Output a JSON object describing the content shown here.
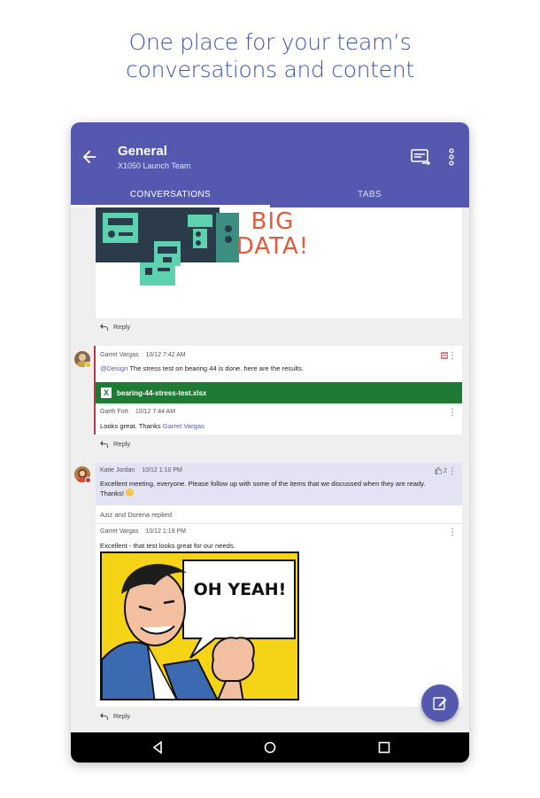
{
  "tagline": {
    "line1": "One place for your team’s",
    "line2": "conversations and content"
  },
  "appbar": {
    "title": "General",
    "subtitle": "X1050 Launch Team",
    "back_icon": "arrow-left-icon",
    "meet_icon": "meeting-icon",
    "more_icon": "more-vertical-icon",
    "color": "#5558af"
  },
  "tabs": [
    {
      "label": "CONVERSATIONS",
      "active": true
    },
    {
      "label": "TABS",
      "active": false
    }
  ],
  "posts": {
    "bigdata": {
      "image_text_line1": "BIG",
      "image_text_line2": "DATA!",
      "reply": "Reply"
    },
    "thread1": {
      "author": "Garret Vargas",
      "time": "10/12 7:42 AM",
      "mention": "@Design",
      "text": " The stress test on bearing 44 is done. here are the results.",
      "file_name": "bearing-44-stress-test.xlsx",
      "reply_author": "Garth Fort",
      "reply_time": "10/12 7:44 AM",
      "reply_text": "Looks great. Thanks ",
      "reply_mention": "Garret Vargas",
      "reply": "Reply"
    },
    "thread2": {
      "author": "Katie Jordan",
      "time": "10/12 1:10 PM",
      "likes": "2",
      "text": "Excellent meeting, everyone. Please follow up with some of the items that we discussed when they are ready. Thanks! ",
      "replied_summary": "Aziz and Dorena replied",
      "reply_author": "Garret Vargas",
      "reply_time": "10/12 1:19 PM",
      "reply_text": "Excellent - that test looks great for our needs.",
      "image_caption": "OH YEAH!",
      "reply": "Reply"
    }
  },
  "fab_icon": "compose-icon",
  "nav": {
    "back_icon": "nav-back-icon",
    "home_icon": "nav-home-icon",
    "recents_icon": "nav-recents-icon"
  }
}
